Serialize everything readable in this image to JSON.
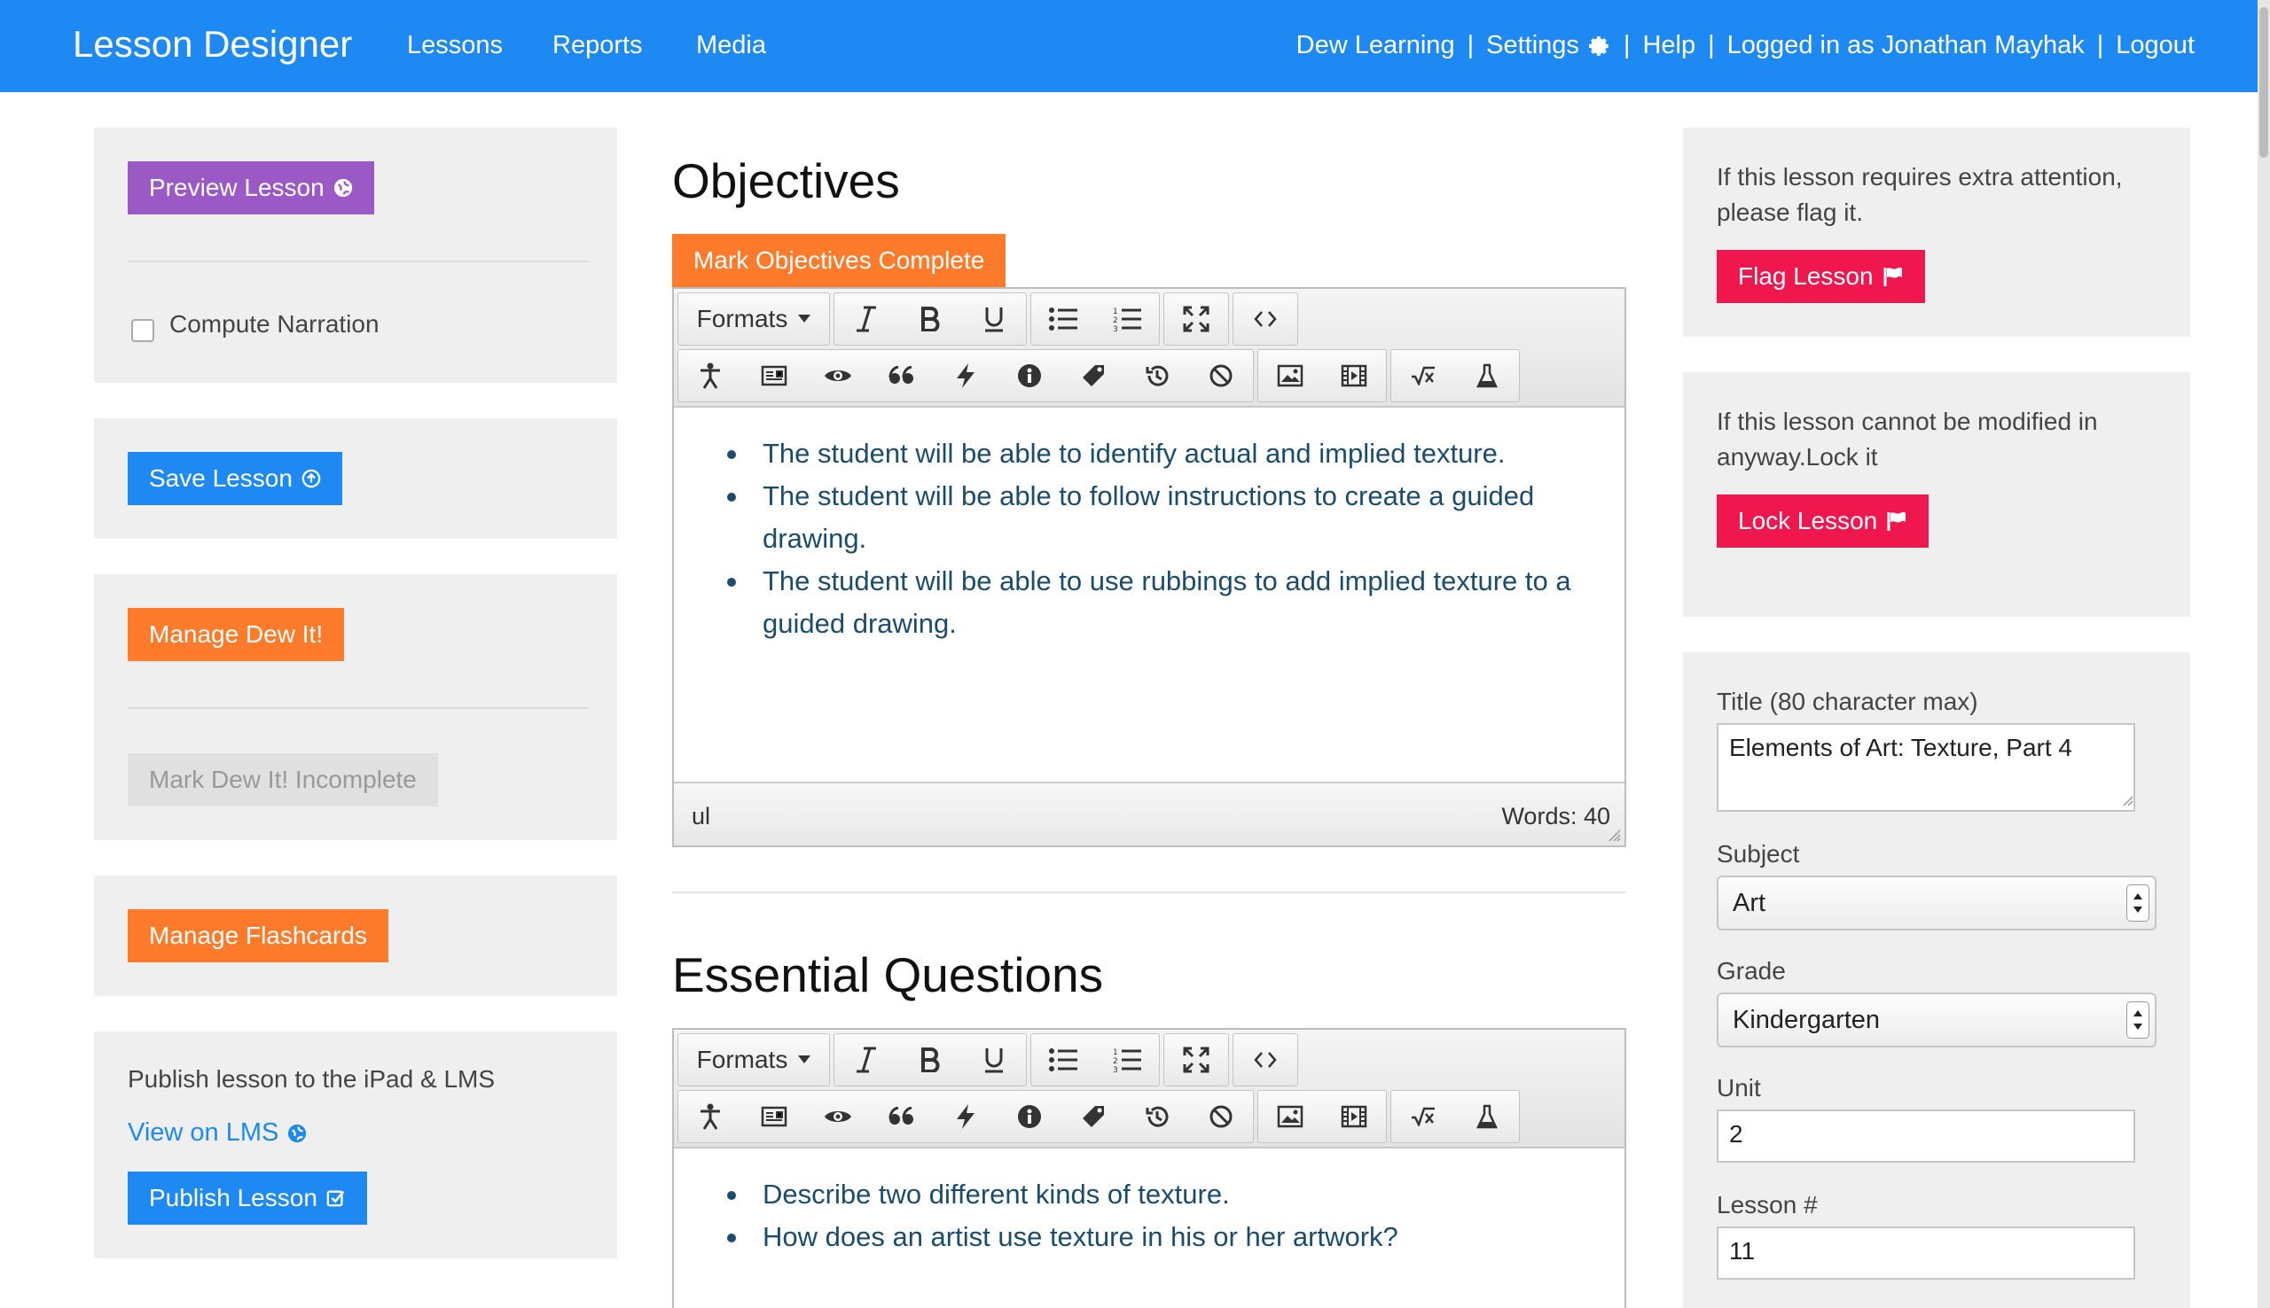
{
  "navbar": {
    "brand": "Lesson Designer",
    "links": [
      "Lessons",
      "Reports",
      "Media"
    ],
    "right": {
      "org": "Dew Learning",
      "settings": "Settings",
      "help": "Help",
      "user": "Logged in as Jonathan Mayhak",
      "logout": "Logout",
      "separator": "|"
    },
    "color": "#1e88f3"
  },
  "left": {
    "preview_button": "Preview Lesson",
    "compute_narration": "Compute Narration",
    "compute_narration_checked": false,
    "save_button": "Save Lesson",
    "manage_dew_it_button": "Manage Dew It!",
    "mark_dew_it_incomplete": "Mark Dew It! Incomplete",
    "manage_flashcards_button": "Manage Flashcards",
    "publish_text": "Publish lesson to the iPad & LMS",
    "view_on_lms": "View on LMS",
    "publish_button": "Publish Lesson"
  },
  "objectives": {
    "heading": "Objectives",
    "mark_complete_button": "Mark Objectives Complete",
    "formats_label": "Formats",
    "items": [
      "The student will be able to identify actual and implied texture.",
      "The student will be able to follow instructions to create a guided drawing.",
      "The student will be able to use rubbings to add implied texture to a guided drawing."
    ],
    "status_path": "ul",
    "word_count": "Words: 40"
  },
  "essential_questions": {
    "heading": "Essential Questions",
    "formats_label": "Formats",
    "items": [
      "Describe two different kinds of texture.",
      "How does an artist use texture in his or her artwork?"
    ]
  },
  "toolbar_icons": {
    "row1": [
      "italic-icon",
      "bold-icon",
      "underline-icon",
      "bullet-list-icon",
      "numbered-list-icon",
      "fullscreen-icon",
      "source-code-icon"
    ],
    "row2": [
      "accessibility-icon",
      "newspaper-icon",
      "eye-icon",
      "quote-icon",
      "lightning-icon",
      "info-icon",
      "tag-icon",
      "history-icon",
      "block-icon",
      "image-icon",
      "video-icon",
      "sqrt-icon",
      "flask-icon"
    ]
  },
  "right": {
    "flag_text": "If this lesson requires extra attention, please flag it.",
    "flag_button": "Flag Lesson",
    "lock_text": "If this lesson cannot be modified in anyway.Lock it",
    "lock_button": "Lock Lesson",
    "title_label": "Title (80 character max)",
    "title_value": "Elements of Art: Texture, Part 4",
    "subject_label": "Subject",
    "subject_value": "Art",
    "grade_label": "Grade",
    "grade_value": "Kindergarten",
    "unit_label": "Unit",
    "unit_value": "2",
    "lesson_label": "Lesson #",
    "lesson_value": "11"
  }
}
